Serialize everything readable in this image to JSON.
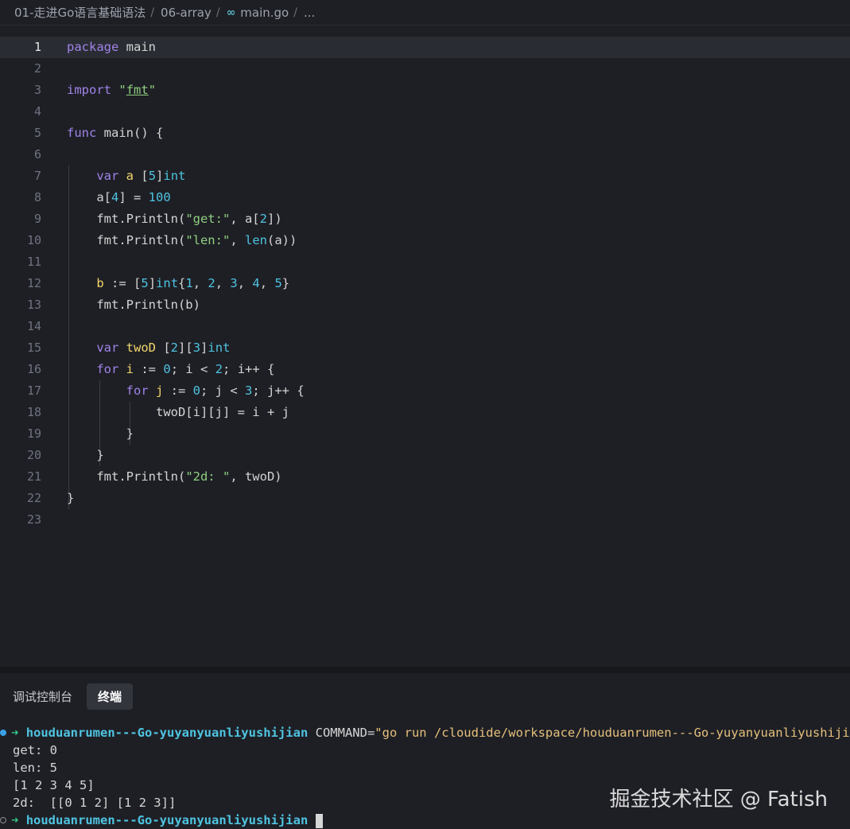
{
  "breadcrumb": {
    "items": [
      "01-走进Go语言基础语法",
      "06-array",
      "main.go",
      "..."
    ],
    "separator": "/",
    "file_icon": "go-file-icon"
  },
  "editor": {
    "active_line": 1,
    "line_numbers": [
      "1",
      "2",
      "3",
      "4",
      "5",
      "6",
      "7",
      "8",
      "9",
      "10",
      "11",
      "12",
      "13",
      "14",
      "15",
      "16",
      "17",
      "18",
      "19",
      "20",
      "21",
      "22",
      "23"
    ],
    "lines": [
      "package main",
      "",
      "import \"fmt\"",
      "",
      "func main() {",
      "",
      "    var a [5]int",
      "    a[4] = 100",
      "    fmt.Println(\"get:\", a[2])",
      "    fmt.Println(\"len:\", len(a))",
      "",
      "    b := [5]int{1, 2, 3, 4, 5}",
      "    fmt.Println(b)",
      "",
      "    var twoD [2][3]int",
      "    for i := 0; i < 2; i++ {",
      "        for j := 0; j < 3; j++ {",
      "            twoD[i][j] = i + j",
      "        }",
      "    }",
      "    fmt.Println(\"2d: \", twoD)",
      "}",
      ""
    ]
  },
  "panel": {
    "tabs": [
      {
        "label": "调试控制台",
        "active": false
      },
      {
        "label": "终端",
        "active": true
      }
    ]
  },
  "terminal": {
    "prompt_arrow": "➜",
    "host": "houduanrumen---Go-yuyanyuanliyushijian",
    "command_prefix": " COMMAND=",
    "command_value": "\"go run /cloudide/workspace/houduanrumen---Go-yuyanyuanliyushijian/",
    "output": [
      "get: 0",
      "len: 5",
      "[1 2 3 4 5]",
      "2d:  [[0 1 2] [1 2 3]]"
    ],
    "status_dot_color_1": "#3aa0e8",
    "status_dot_color_2": "#8a8d95"
  },
  "watermark": "掘金技术社区 @ Fatish",
  "colors": {
    "background": "#1e1f25",
    "keyword": "#a083e8",
    "type": "#4ec3e0",
    "string": "#8fcf7f",
    "variable": "#f2d76c",
    "prompt_arrow": "#35c48a",
    "host": "#4ec3e0"
  }
}
